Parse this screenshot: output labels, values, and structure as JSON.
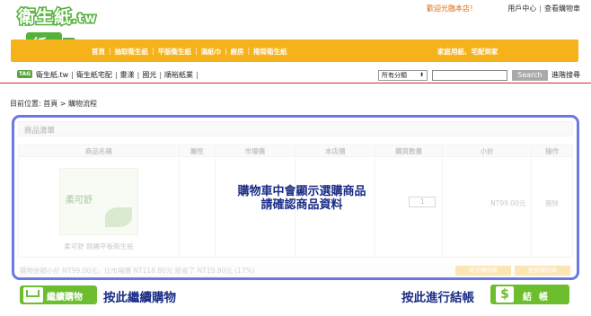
{
  "header": {
    "logo_text": "衛生紙",
    "logo_domain": ".tw",
    "logo_badge": "紙",
    "welcome": "歡迎光臨本店！",
    "toplinks": [
      "用戶中心",
      "查看購物車"
    ]
  },
  "nav": {
    "items": [
      "首頁",
      "抽取衛生紙",
      "平版衛生紙",
      "濕紙巾",
      "廚房",
      "捲筒衛生紙"
    ],
    "right": "家庭用紙、宅配到家"
  },
  "tagbar": {
    "badge": "TAG",
    "links": [
      "衛生紙.tw",
      "衛生紙宅配",
      "靈漾",
      "國光",
      "順裕紙業"
    ],
    "category_selected": "所有分類",
    "search_placeholder": "",
    "search_button": "Search",
    "advanced_search": "進階搜尋"
  },
  "breadcrumb": "目前位置: 首頁 > 購物流程",
  "cart": {
    "title": "商品清單",
    "columns": [
      "商品名稱",
      "屬性",
      "市場價",
      "本店價",
      "購買數量",
      "小計",
      "操作"
    ],
    "rows": [
      {
        "brand": "柔可舒",
        "name": "柔可舒 輕觸平板衛生紙",
        "attribute": "",
        "market_price": "",
        "shop_price": "",
        "quantity": "1",
        "subtotal": "NT99.00元",
        "action": "刪除"
      }
    ],
    "summary": "購物金額小計 NT99.00元，比市場價 NT118.80元 節省了 NT19.80元 (17%)",
    "buttons": [
      "清空購物車",
      "更新購物車"
    ]
  },
  "overlay_message": [
    "購物車中會顯示選購商品",
    "請確認商品資料"
  ],
  "footer": {
    "continue_label": "繼續購物",
    "continue_note": "按此繼續購物",
    "checkout_note": "按此進行結帳",
    "checkout_label": "結帳",
    "dollar_symbol": "$"
  }
}
